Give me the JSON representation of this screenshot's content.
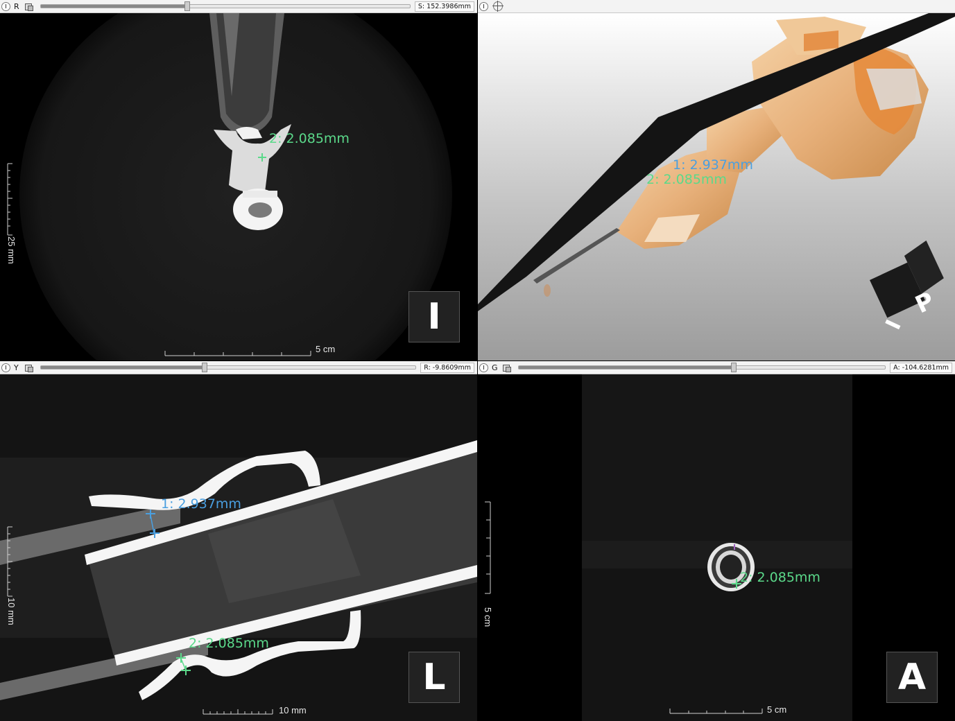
{
  "views": {
    "top_left": {
      "toolbar_letter": "R",
      "readout": "S: 152.3986mm",
      "slider_fraction": 0.39,
      "orientation": "I",
      "measurement_green": "2: 2.085mm",
      "vertical_scale_label": "25 mm",
      "horizontal_scale_label": "5 cm"
    },
    "top_right": {
      "measurement_blue": "1: 2.937mm",
      "measurement_green": "2: 2.085mm",
      "cube_top": "P",
      "cube_bottom": "I"
    },
    "bottom_left": {
      "toolbar_letter": "Y",
      "readout": "R: -9.8609mm",
      "slider_fraction": 0.43,
      "orientation": "L",
      "measurement_blue": "1: 2.937mm",
      "measurement_green": "2: 2.085mm",
      "vertical_scale_label": "10 mm",
      "horizontal_scale_label": "10 mm"
    },
    "bottom_right": {
      "toolbar_letter": "G",
      "readout": "A: -104.6281mm",
      "slider_fraction": 0.58,
      "orientation": "A",
      "measurement_green": "2: 2.085mm",
      "vertical_scale_label": "5 cm",
      "horizontal_scale_label": "5 cm"
    }
  },
  "colors": {
    "measure_green": "#5bd98a",
    "measure_blue": "#4a9fe0",
    "volume_orange": "#e89a4a"
  },
  "icons": [
    "view-controller-toggle-icon",
    "link-views-icon",
    "center-target-icon"
  ]
}
